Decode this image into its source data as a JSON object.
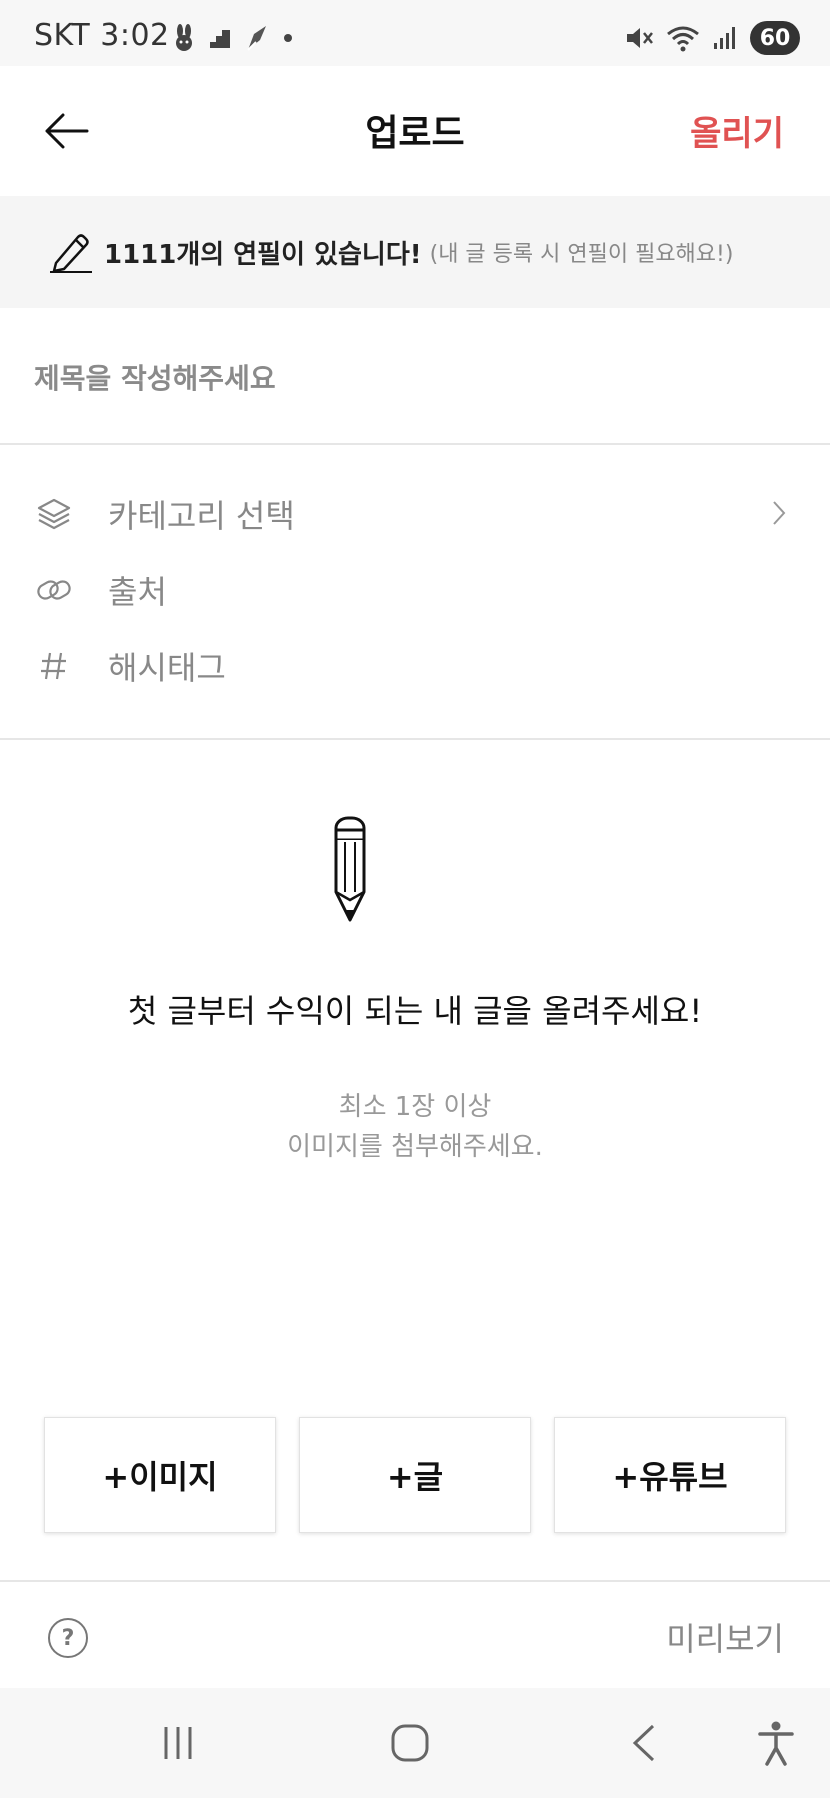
{
  "status_bar": {
    "carrier_time": "SKT 3:02",
    "battery": "60"
  },
  "header": {
    "title": "업로드",
    "submit_label": "올리기"
  },
  "notice": {
    "strong": "1111개의 연필이 있습니다!",
    "sub": "(내 글 등록 시 연필이 필요해요!)"
  },
  "title_input": {
    "placeholder": "제목을 작성해주세요",
    "value": ""
  },
  "options": [
    {
      "label": "카테고리 선택",
      "icon": "layers-icon"
    },
    {
      "label": "출처",
      "icon": "link-icon"
    },
    {
      "label": "해시태그",
      "icon": "hashtag-icon"
    }
  ],
  "empty_state": {
    "icon": "pencil-icon",
    "message": "첫 글부터 수익이 되는 내 글을 올려주세요!",
    "sub_line1": "최소 1장 이상",
    "sub_line2": "이미지를 첨부해주세요."
  },
  "add_buttons": [
    {
      "label": "+이미지"
    },
    {
      "label": "+글"
    },
    {
      "label": "+유튜브"
    }
  ],
  "bottom_bar": {
    "help_label": "?",
    "preview_label": "미리보기"
  },
  "colors": {
    "accent": "#e05252",
    "muted": "#888888"
  }
}
